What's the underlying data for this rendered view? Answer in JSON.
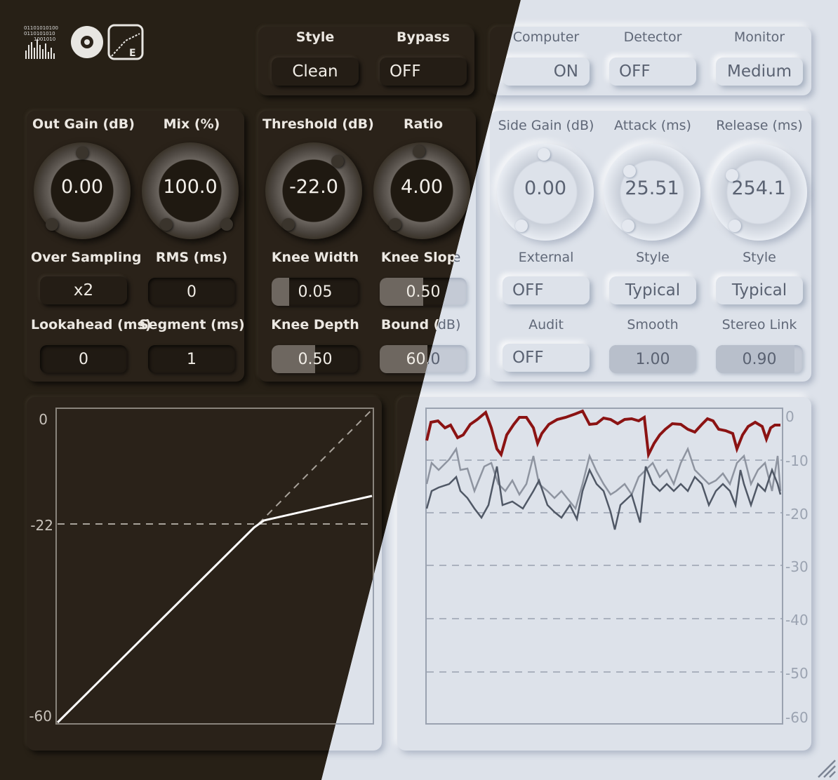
{
  "top": {
    "style": {
      "label": "Style",
      "value": "Clean"
    },
    "bypass": {
      "label": "Bypass",
      "value": "OFF"
    },
    "computer": {
      "label": "Computer",
      "value": "ON"
    },
    "detector": {
      "label": "Detector",
      "value": "OFF"
    },
    "monitor": {
      "label": "Monitor",
      "value": "Medium"
    }
  },
  "knobs": {
    "out_gain": {
      "label": "Out Gain (dB)",
      "value": "0.00"
    },
    "mix": {
      "label": "Mix (%)",
      "value": "100.0"
    },
    "threshold": {
      "label": "Threshold (dB)",
      "value": "-22.0"
    },
    "ratio": {
      "label": "Ratio",
      "value": "4.00"
    },
    "side_gain": {
      "label": "Side Gain (dB)",
      "value": "0.00"
    },
    "attack": {
      "label": "Attack (ms)",
      "value": "25.51"
    },
    "release": {
      "label": "Release (ms)",
      "value": "254.1"
    }
  },
  "controls": {
    "over_sampling": {
      "label": "Over Sampling",
      "value": "x2"
    },
    "rms": {
      "label": "RMS (ms)",
      "value": "0"
    },
    "lookahead": {
      "label": "Lookahead (ms)",
      "value": "0"
    },
    "segment": {
      "label": "Segment (ms)",
      "value": "1"
    },
    "knee_width": {
      "label": "Knee Width",
      "value": "0.05",
      "fill": 0.2
    },
    "knee_slope": {
      "label": "Knee Slope",
      "value": "0.50",
      "fill": 0.5
    },
    "knee_depth": {
      "label": "Knee Depth",
      "value": "0.50",
      "fill": 0.5
    },
    "bound": {
      "label": "Bound (dB)",
      "value": "60.0",
      "fill": 0.55
    },
    "external": {
      "label": "External",
      "value": "OFF"
    },
    "style2": {
      "label": "Style",
      "value": "Typical"
    },
    "style3": {
      "label": "Style",
      "value": "Typical"
    },
    "audit": {
      "label": "Audit",
      "value": "OFF"
    },
    "smooth": {
      "label": "Smooth",
      "value": "1.00",
      "fill": 1.0
    },
    "stereo_link": {
      "label": "Stereo Link",
      "value": "0.90",
      "fill": 0.9
    }
  },
  "curve": {
    "y_ticks": [
      "0",
      "-22",
      "-60"
    ],
    "threshold_db": -22,
    "ratio": 4,
    "range": [
      -60,
      0
    ]
  },
  "meter": {
    "y_ticks": [
      "0",
      "-10",
      "-20",
      "-30",
      "-40",
      "-50",
      "-60"
    ],
    "range": [
      -60,
      0
    ]
  },
  "colors": {
    "accent_line": "#8b1313",
    "curve": "#ffffff"
  }
}
